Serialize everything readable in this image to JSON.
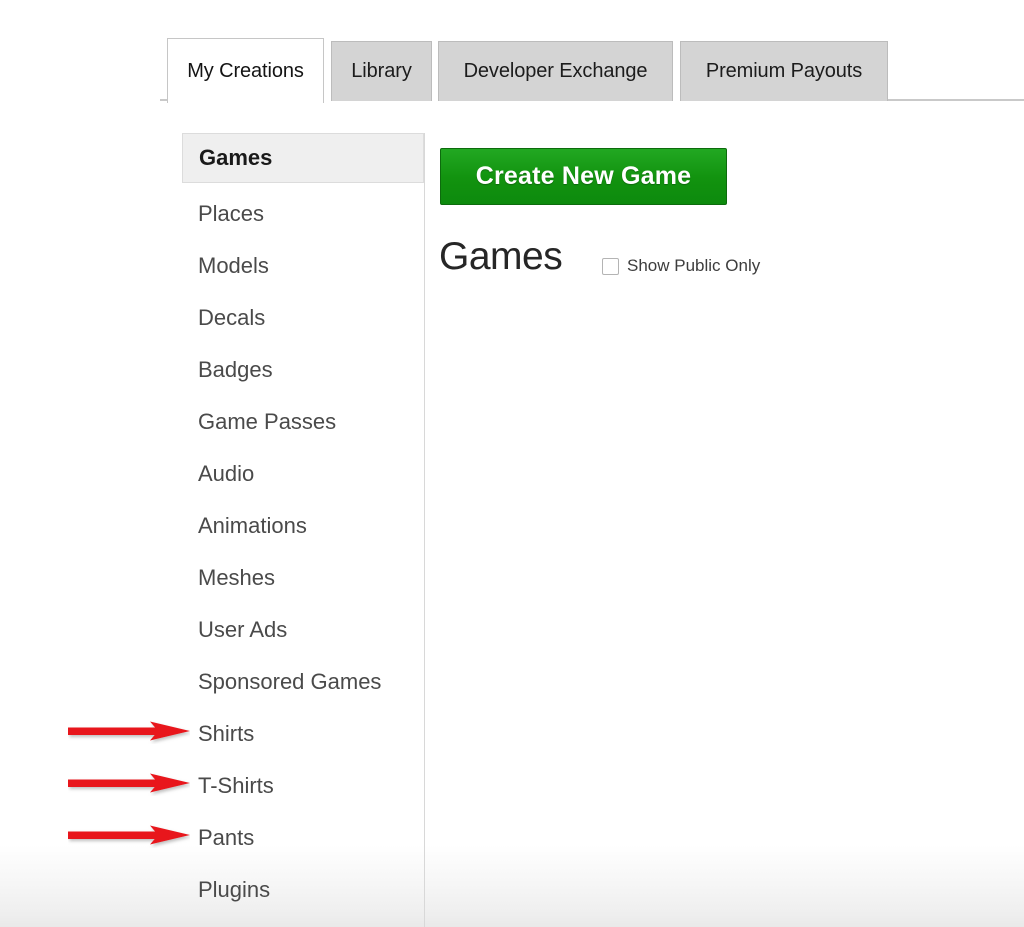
{
  "tabs": [
    {
      "label": "My Creations",
      "active": true
    },
    {
      "label": "Library",
      "active": false
    },
    {
      "label": "Developer Exchange",
      "active": false
    },
    {
      "label": "Premium Payouts",
      "active": false
    }
  ],
  "sidebar": {
    "items": [
      {
        "label": "Games",
        "active": true,
        "arrow": false
      },
      {
        "label": "Places",
        "active": false,
        "arrow": false
      },
      {
        "label": "Models",
        "active": false,
        "arrow": false
      },
      {
        "label": "Decals",
        "active": false,
        "arrow": false
      },
      {
        "label": "Badges",
        "active": false,
        "arrow": false
      },
      {
        "label": "Game Passes",
        "active": false,
        "arrow": false
      },
      {
        "label": "Audio",
        "active": false,
        "arrow": false
      },
      {
        "label": "Animations",
        "active": false,
        "arrow": false
      },
      {
        "label": "Meshes",
        "active": false,
        "arrow": false
      },
      {
        "label": "User Ads",
        "active": false,
        "arrow": false
      },
      {
        "label": "Sponsored Games",
        "active": false,
        "arrow": false
      },
      {
        "label": "Shirts",
        "active": false,
        "arrow": true
      },
      {
        "label": "T-Shirts",
        "active": false,
        "arrow": true
      },
      {
        "label": "Pants",
        "active": false,
        "arrow": true
      },
      {
        "label": "Plugins",
        "active": false,
        "arrow": false
      }
    ]
  },
  "main": {
    "create_button_label": "Create New Game",
    "heading": "Games",
    "show_public_only_label": "Show Public Only",
    "show_public_only_checked": false
  },
  "annotations": {
    "arrow_color": "#e8151b",
    "arrow_icon": "arrow-right-icon",
    "targets": [
      "Shirts",
      "T-Shirts",
      "Pants"
    ]
  },
  "colors": {
    "accent_green": "#12930f",
    "green_border": "#0d6b0d",
    "tab_inactive_bg": "#d4d4d4",
    "tab_active_bg": "#ffffff",
    "sidebar_active_bg": "#efefef",
    "text": "#4a4a4a",
    "arrow_red": "#e8151b"
  }
}
